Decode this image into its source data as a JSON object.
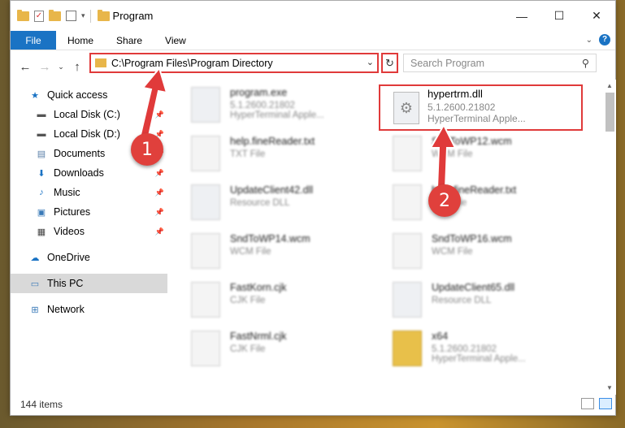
{
  "window": {
    "title": "Program"
  },
  "ribbon": {
    "tabs": [
      "File",
      "Home",
      "Share",
      "View"
    ]
  },
  "address": {
    "path": "C:\\Program Files\\Program Directory"
  },
  "search": {
    "placeholder": "Search Program"
  },
  "sidebar": {
    "quick_access": "Quick access",
    "items": [
      {
        "label": "Local Disk (C:)",
        "icon": "drive-icon",
        "pinned": true
      },
      {
        "label": "Local Disk (D:)",
        "icon": "drive-icon",
        "pinned": true
      },
      {
        "label": "Documents",
        "icon": "documents-icon",
        "pinned": true
      },
      {
        "label": "Downloads",
        "icon": "downloads-icon",
        "pinned": true
      },
      {
        "label": "Music",
        "icon": "music-icon",
        "pinned": true
      },
      {
        "label": "Pictures",
        "icon": "pictures-icon",
        "pinned": true
      },
      {
        "label": "Videos",
        "icon": "videos-icon",
        "pinned": true
      }
    ],
    "onedrive": "OneDrive",
    "this_pc": "This PC",
    "network": "Network"
  },
  "files": [
    {
      "name": "program.exe",
      "sub1": "5.1.2600.21802",
      "sub2": "HyperTerminal Apple...",
      "kind": "exe"
    },
    {
      "name": "hypertrm.dll",
      "sub1": "5.1.2600.21802",
      "sub2": "HyperTerminal Apple...",
      "kind": "dll"
    },
    {
      "name": "help.fineReader.txt",
      "sub1": "TXT File",
      "kind": "txt"
    },
    {
      "name": "SndToWP12.wcm",
      "sub1": "WCM File",
      "kind": "file"
    },
    {
      "name": "UpdateClient42.dll",
      "sub1": "Resource DLL",
      "kind": "dll"
    },
    {
      "name": "help.fineReader.txt",
      "sub1": "TXT File",
      "kind": "txt"
    },
    {
      "name": "SndToWP14.wcm",
      "sub1": "WCM File",
      "kind": "file"
    },
    {
      "name": "SndToWP16.wcm",
      "sub1": "WCM File",
      "kind": "file"
    },
    {
      "name": "FastKorn.cjk",
      "sub1": "CJK File",
      "kind": "file"
    },
    {
      "name": "UpdateClient65.dll",
      "sub1": "Resource DLL",
      "kind": "dll"
    },
    {
      "name": "FastNrml.cjk",
      "sub1": "CJK File",
      "kind": "file"
    },
    {
      "name": "x64",
      "sub1": "5.1.2600.21802",
      "sub2": "HyperTerminal Apple...",
      "kind": "folder"
    }
  ],
  "status": {
    "items_count": "144 items"
  },
  "annotations": {
    "marker1": "1",
    "marker2": "2"
  },
  "colors": {
    "highlight": "#e03a3a",
    "accent": "#1a73c4"
  }
}
